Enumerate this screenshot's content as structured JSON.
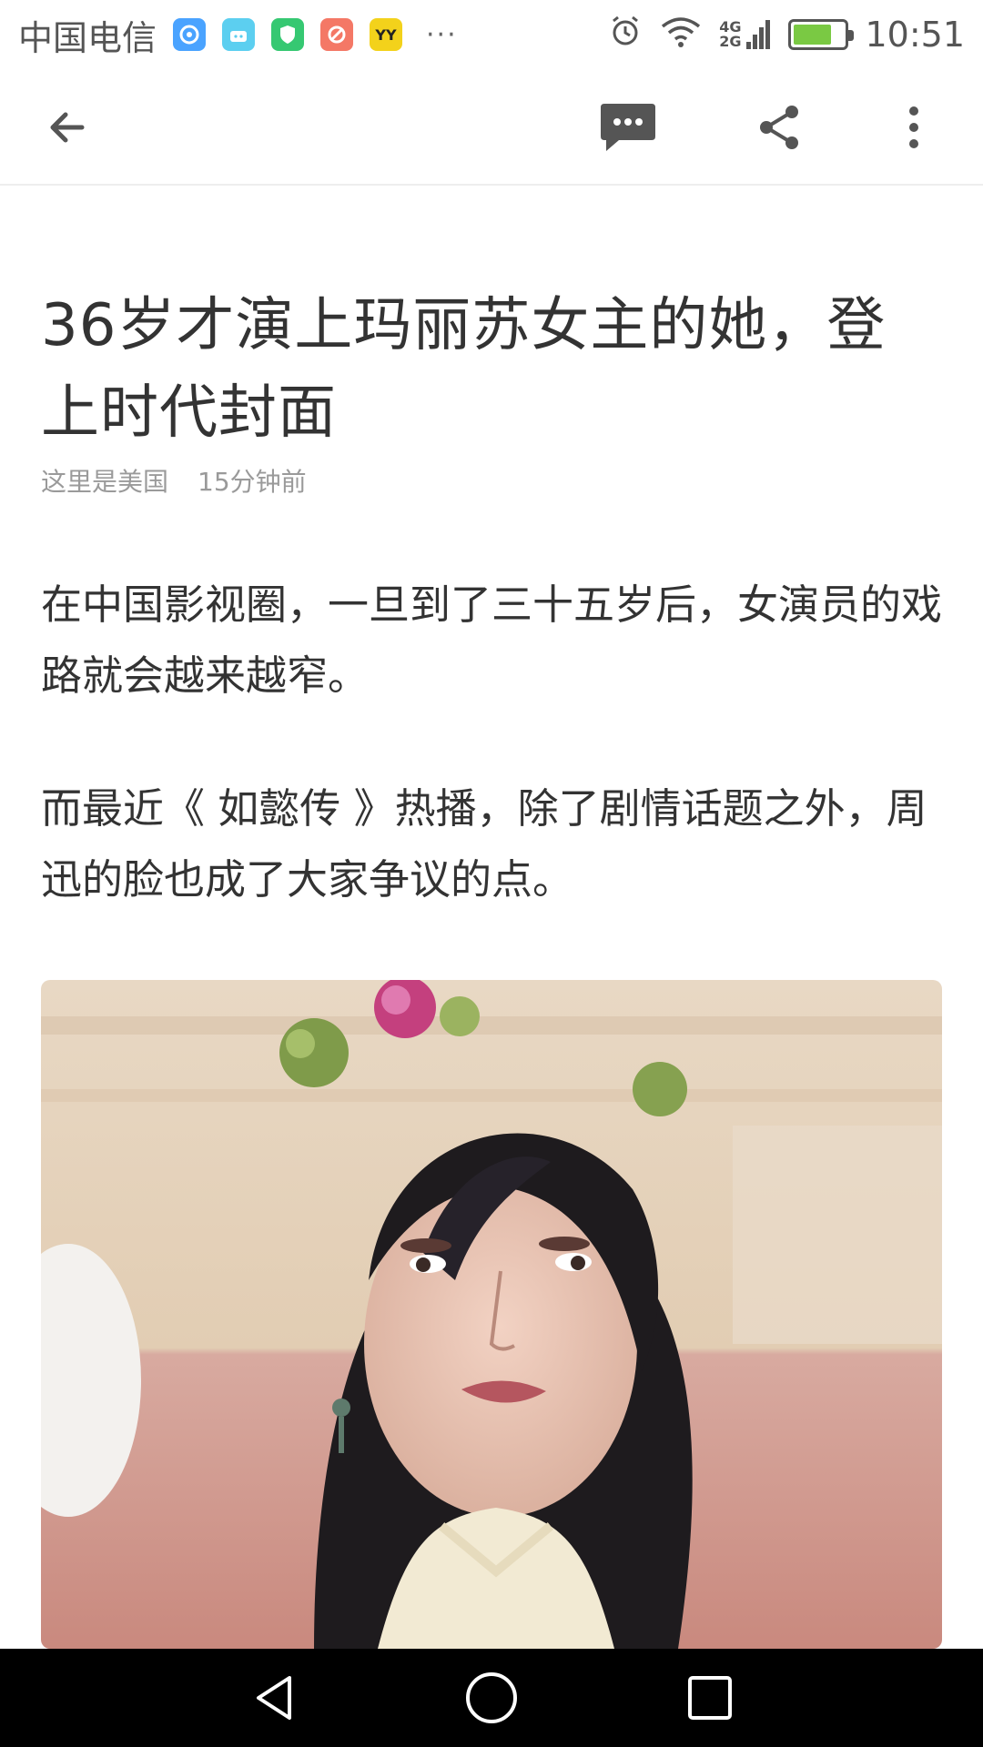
{
  "status_bar": {
    "carrier": "中国电信",
    "app_icons": [
      {
        "name": "browser-app-icon",
        "color": "#4aa3ff"
      },
      {
        "name": "android-app-icon",
        "color": "#5ccff0"
      },
      {
        "name": "shield-app-icon",
        "color": "#36c872"
      },
      {
        "name": "tools-app-icon",
        "color": "#f47866"
      },
      {
        "name": "yy-app-icon",
        "color": "#f3d21b",
        "text": "YY"
      }
    ],
    "more": "···",
    "network": {
      "top": "4G",
      "bottom": "2G"
    },
    "battery_level": 0.75,
    "time": "10:51"
  },
  "app_bar": {
    "back": "back-arrow-icon",
    "comment": "comment-icon",
    "share": "share-icon",
    "more": "more-vert-icon"
  },
  "article": {
    "title": "36岁才演上玛丽苏女主的她，登上时代封面",
    "source": "这里是美国",
    "time": "15分钟前",
    "paragraphs": [
      "在中国影视圈，一旦到了三十五岁后，女演员的戏路就会越来越窄。",
      "而最近《 如懿传 》热播，除了剧情话题之外，周迅的脸也成了大家争议的点。"
    ]
  },
  "nav_bar": {
    "back": "nav-back-icon",
    "home": "nav-home-icon",
    "recents": "nav-recents-icon"
  },
  "colors": {
    "accent_battery": "#7ac943",
    "nav_bg": "#000000",
    "title_text": "#333333",
    "meta_text": "#9a9a9a"
  }
}
